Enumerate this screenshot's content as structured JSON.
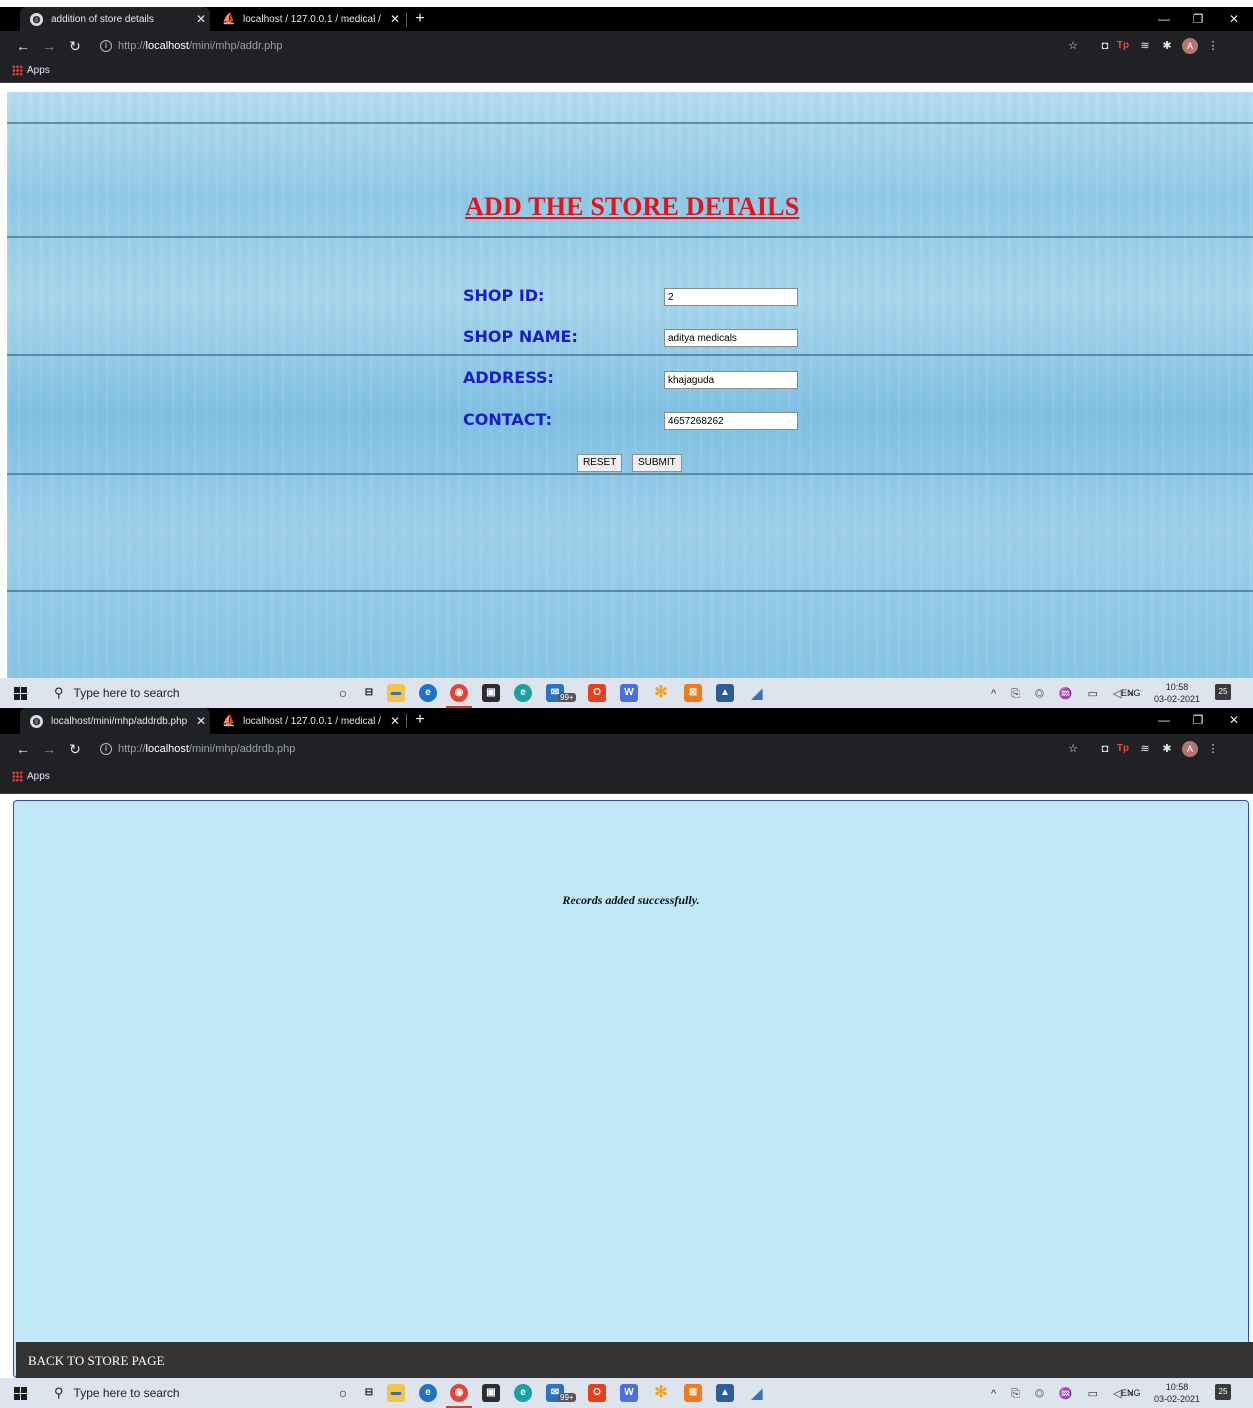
{
  "screenshot_top": {
    "tabs": [
      {
        "title": "addition of store details",
        "favicon": "globe-icon",
        "active": true
      },
      {
        "title": "localhost / 127.0.0.1 / medical /  ",
        "favicon": "phpmyadmin-icon",
        "active": false
      }
    ],
    "url": {
      "protocol": "http://",
      "host": "localhost",
      "path": "/mini/mhp/addr.php"
    },
    "bookmarks": {
      "apps_label": "Apps"
    },
    "page": {
      "title": "ADD THE STORE DETAILS",
      "fields": [
        {
          "label": "SHOP ID:",
          "value": "2"
        },
        {
          "label": "SHOP NAME:",
          "value": "aditya medicals"
        },
        {
          "label": "ADDRESS:",
          "value": "khajaguda"
        },
        {
          "label": "CONTACT:",
          "value": "4657268262"
        }
      ],
      "reset_label": "RESET",
      "submit_label": "SUBMIT"
    },
    "taskbar": {
      "search_placeholder": "Type here to search",
      "lang": "ENG",
      "time": "10:58",
      "date": "03-02-2021",
      "notifications": "25",
      "mail_badge": "99+"
    }
  },
  "screenshot_bottom": {
    "tabs": [
      {
        "title": "localhost/mini/mhp/addrdb.php",
        "favicon": "globe-icon",
        "active": true
      },
      {
        "title": "localhost / 127.0.0.1 / medical /  ",
        "favicon": "phpmyadmin-icon",
        "active": false
      }
    ],
    "url": {
      "protocol": "http://",
      "host": "localhost",
      "path": "/mini/mhp/addrdb.php"
    },
    "bookmarks": {
      "apps_label": "Apps"
    },
    "page": {
      "message": "Records added successfully.",
      "back_link": "BACK TO STORE PAGE"
    },
    "taskbar": {
      "search_placeholder": "Type here to search",
      "lang": "ENG",
      "time": "10:58",
      "date": "03-02-2021",
      "notifications": "25",
      "mail_badge": "99+"
    }
  },
  "colors": {
    "title_red": "#e0141b",
    "label_blue": "#1a1fc4",
    "result_bg": "#c0e8f7",
    "footer_bg": "#333333"
  }
}
